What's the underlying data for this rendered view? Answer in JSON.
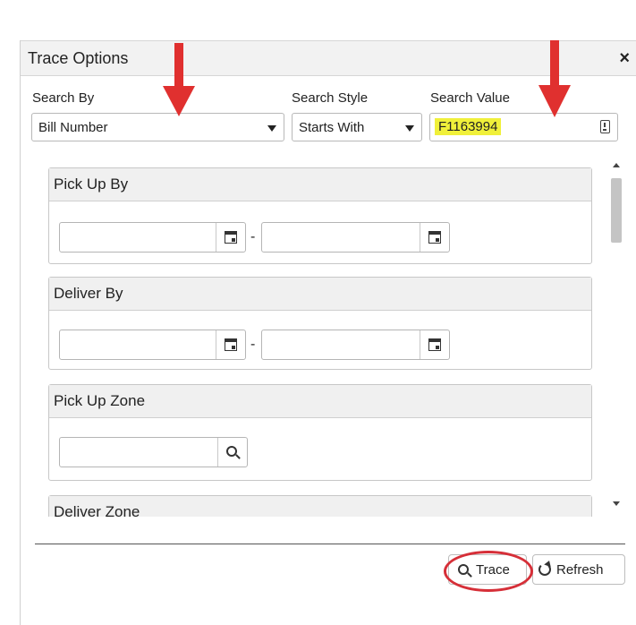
{
  "dialog": {
    "title": "Trace Options",
    "close_label": "×"
  },
  "search": {
    "by_label": "Search By",
    "by_value": "Bill Number",
    "style_label": "Search Style",
    "style_value": "Starts With",
    "value_label": "Search Value",
    "value_text": "F1163994"
  },
  "panels": {
    "pickup_by": "Pick Up By",
    "deliver_by": "Deliver By",
    "pickup_zone": "Pick Up Zone",
    "deliver_zone": "Deliver Zone",
    "range_separator": "-"
  },
  "footer": {
    "trace_label": "Trace",
    "refresh_label": "Refresh"
  },
  "annotations": {
    "arrow_color": "#e0302f",
    "circle_color": "#d62f38",
    "highlight_color": "#f0f03a"
  }
}
